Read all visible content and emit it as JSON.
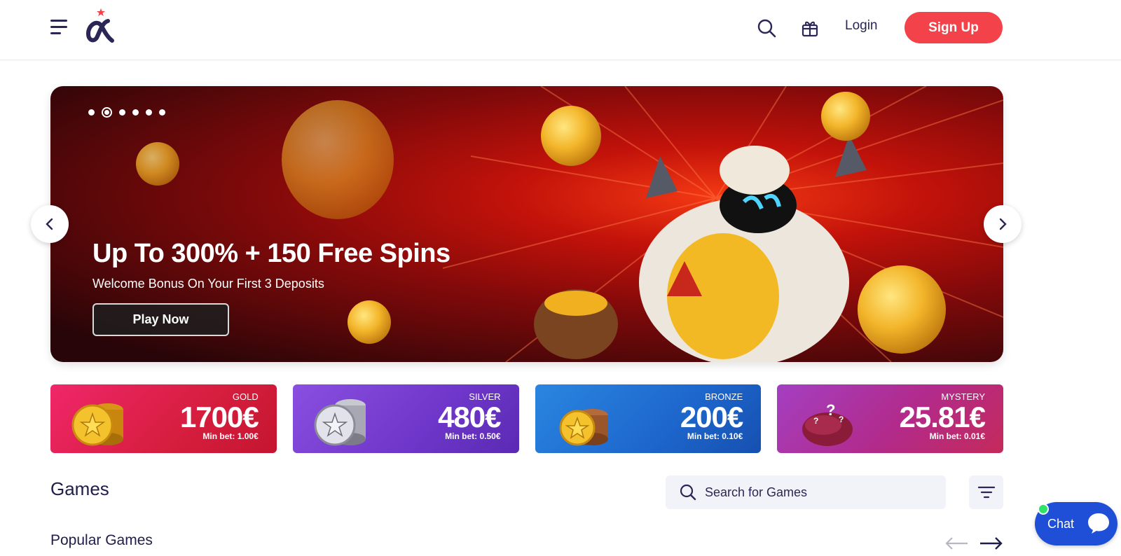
{
  "header": {
    "login_label": "Login",
    "signup_label": "Sign Up",
    "brand_color": "#f4424a"
  },
  "banner": {
    "title": "Up To 300% + 150 Free Spins",
    "subtitle": "Welcome Bonus On Your First 3 Deposits",
    "cta_label": "Play Now",
    "slide_count": 6,
    "active_slide": 2
  },
  "jackpots": [
    {
      "label": "GOLD",
      "amount": "1700€",
      "min_bet": "Min bet: 1.00€",
      "color": "#e8264f"
    },
    {
      "label": "SILVER",
      "amount": "480€",
      "min_bet": "Min bet: 0.50€",
      "color": "#7b3fd6"
    },
    {
      "label": "BRONZE",
      "amount": "200€",
      "min_bet": "Min bet: 0.10€",
      "color": "#1f6bd0"
    },
    {
      "label": "MYSTERY",
      "amount": "25.81€",
      "min_bet": "Min bet: 0.01€",
      "color": "#b02d9a"
    }
  ],
  "games": {
    "title": "Games",
    "search_placeholder": "Search for Games",
    "popular_title": "Popular Games"
  },
  "chat": {
    "label": "Chat",
    "color": "#1e4fd6"
  }
}
